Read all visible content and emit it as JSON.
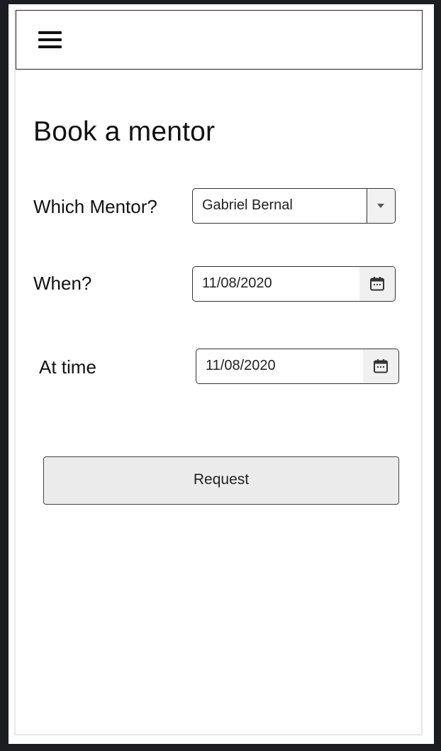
{
  "page": {
    "title": "Book a mentor"
  },
  "form": {
    "mentor": {
      "label": "Which Mentor?",
      "value": "Gabriel Bernal"
    },
    "when": {
      "label": "When?",
      "value": "11/08/2020"
    },
    "time": {
      "label": "At time",
      "value": "11/08/2020"
    },
    "submit_label": "Request"
  },
  "icons": {
    "menu": "hamburger-menu-icon",
    "dropdown": "caret-down-icon",
    "calendar": "calendar-icon"
  }
}
